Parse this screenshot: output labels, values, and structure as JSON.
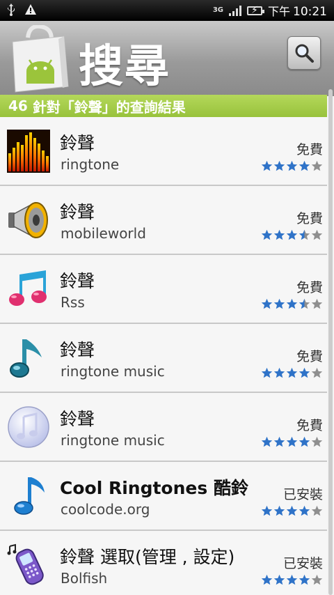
{
  "status_bar": {
    "usb_icon": "usb-icon",
    "warning_icon": "warning-icon",
    "network": "3G",
    "ampm": "下午",
    "time": "10:21"
  },
  "header": {
    "title": "搜尋",
    "search_icon": "magnifier-icon"
  },
  "results": {
    "count": "46",
    "query_text": "針對「鈴聲」的查詢結果"
  },
  "apps": [
    {
      "name": "鈴聲",
      "developer": "ringtone",
      "price": "免費",
      "rating": 4,
      "icon": "equalizer-icon"
    },
    {
      "name": "鈴聲",
      "developer": "mobileworld",
      "price": "免費",
      "rating": 3.5,
      "icon": "speaker-icon"
    },
    {
      "name": "鈴聲",
      "developer": "Rss",
      "price": "免費",
      "rating": 3.5,
      "icon": "music-notes-icon"
    },
    {
      "name": "鈴聲",
      "developer": "ringtone music",
      "price": "免費",
      "rating": 4,
      "icon": "music-note-icon"
    },
    {
      "name": "鈴聲",
      "developer": "ringtone music",
      "price": "免費",
      "rating": 4,
      "icon": "music-disc-icon"
    },
    {
      "name": "Cool Ringtones 酷鈴",
      "developer": "coolcode.org",
      "price": "已安裝",
      "rating": 4,
      "icon": "blue-note-icon"
    },
    {
      "name": "鈴聲 選取(管理 , 設定)",
      "developer": "Bolfish",
      "price": "已安裝",
      "rating": 4,
      "icon": "phone-icon"
    }
  ],
  "colors": {
    "result_bar": "#a5cd45",
    "star_on": "#2f73c8",
    "star_off": "#8f8f8f"
  }
}
